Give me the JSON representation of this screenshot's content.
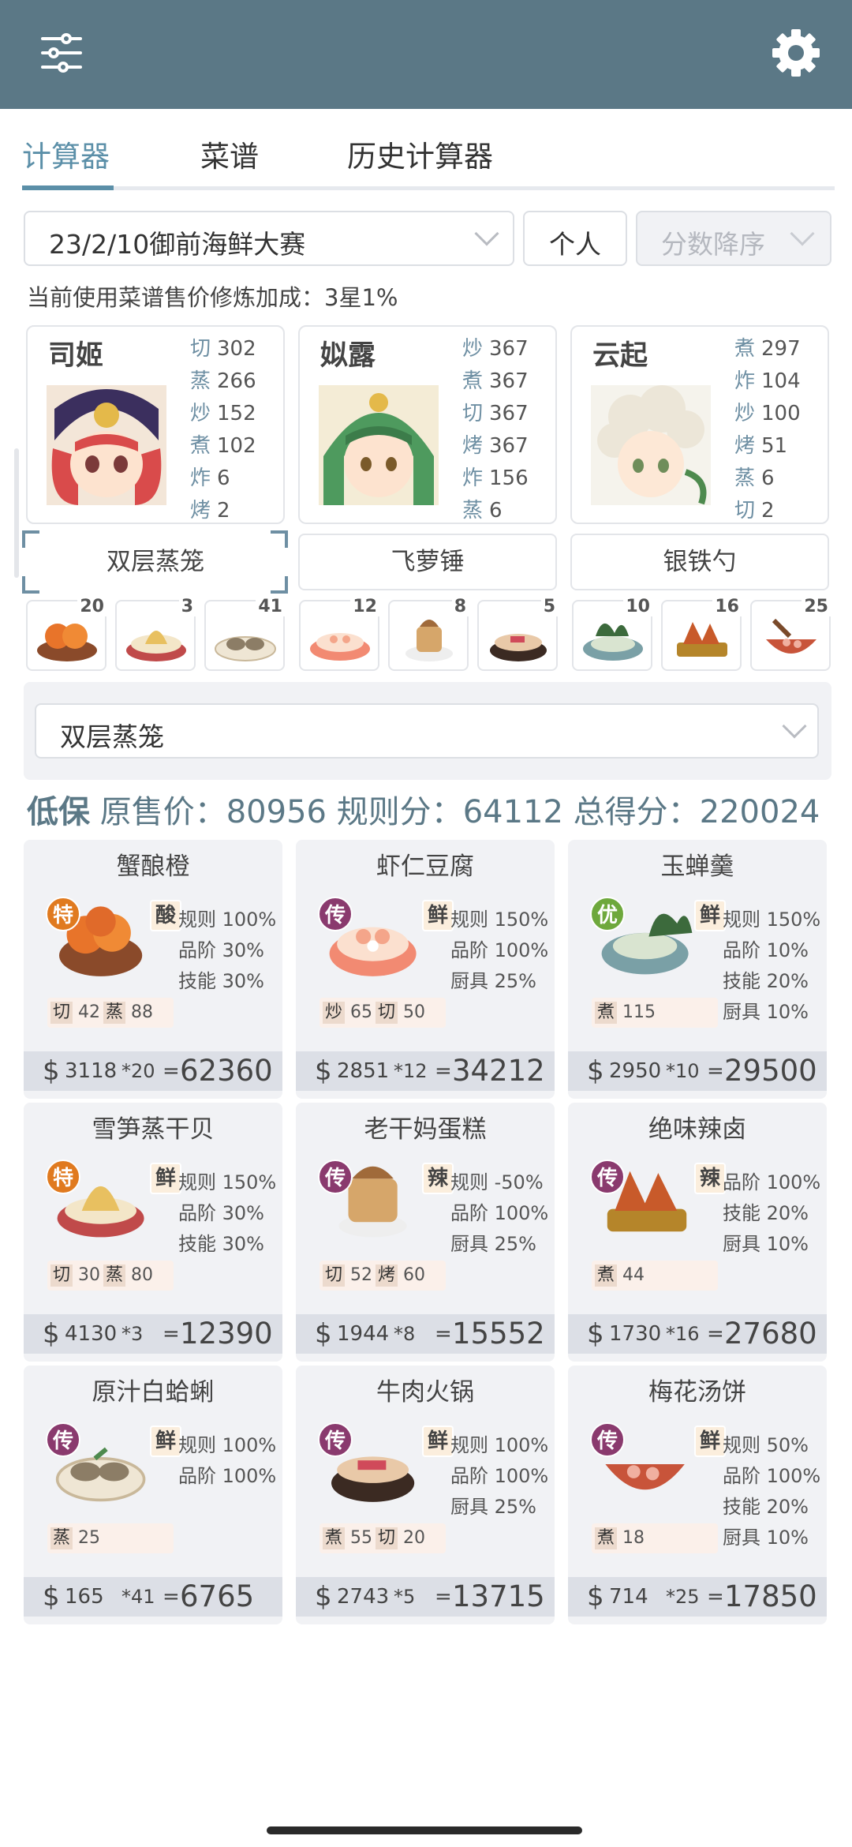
{
  "header": {
    "filter_icon": "sliders-icon",
    "settings_icon": "gear-icon"
  },
  "tabs": [
    {
      "label": "计算器",
      "active": true
    },
    {
      "label": "菜谱"
    },
    {
      "label": "历史计算器"
    }
  ],
  "controls": {
    "contest": "23/2/10御前海鲜大赛",
    "personal": "个人",
    "sort": "分数降序"
  },
  "bonus_note": "当前使用菜谱售价修炼加成：3星1%",
  "chefs": [
    {
      "name": "司姬",
      "skills": [
        {
          "k": "切",
          "v": "302"
        },
        {
          "k": "蒸",
          "v": "266"
        },
        {
          "k": "炒",
          "v": "152"
        },
        {
          "k": "煮",
          "v": "102"
        },
        {
          "k": "炸",
          "v": "6"
        },
        {
          "k": "烤",
          "v": "2"
        }
      ],
      "equip": "双层蒸笼"
    },
    {
      "name": "姒露",
      "skills": [
        {
          "k": "炒",
          "v": "367"
        },
        {
          "k": "煮",
          "v": "367"
        },
        {
          "k": "切",
          "v": "367"
        },
        {
          "k": "烤",
          "v": "367"
        },
        {
          "k": "炸",
          "v": "156"
        },
        {
          "k": "蒸",
          "v": "6"
        }
      ],
      "equip": "飞萝锤"
    },
    {
      "name": "云起",
      "skills": [
        {
          "k": "煮",
          "v": "297"
        },
        {
          "k": "炸",
          "v": "104"
        },
        {
          "k": "炒",
          "v": "100"
        },
        {
          "k": "烤",
          "v": "51"
        },
        {
          "k": "蒸",
          "v": "6"
        },
        {
          "k": "切",
          "v": "2"
        }
      ],
      "equip": "银铁勺"
    }
  ],
  "dish_slots": [
    "20",
    "3",
    "41",
    "12",
    "8",
    "5",
    "10",
    "16",
    "25"
  ],
  "recipe_select": "双层蒸笼",
  "summary": {
    "guarantee": "低保",
    "orig_label": "原售价：",
    "orig": "80956",
    "rule_label": "规则分：",
    "rule": "64112",
    "total_label": "总得分：",
    "total": "220024"
  },
  "recipes": [
    {
      "name": "蟹酿橙",
      "rarity": "特",
      "flavor": "酸",
      "bonuses": [
        "规则 100%",
        "品阶 30%",
        "技能 30%"
      ],
      "reqs": [
        {
          "k": "切",
          "v": "42"
        },
        {
          "k": "蒸",
          "v": "88"
        }
      ],
      "price": "3118",
      "qty": "*20",
      "total": "62360"
    },
    {
      "name": "虾仁豆腐",
      "rarity": "传",
      "flavor": "鲜",
      "bonuses": [
        "规则 150%",
        "品阶 100%",
        "厨具 25%"
      ],
      "reqs": [
        {
          "k": "炒",
          "v": "65"
        },
        {
          "k": "切",
          "v": "50"
        }
      ],
      "price": "2851",
      "qty": "*12",
      "total": "34212"
    },
    {
      "name": "玉蝉羹",
      "rarity": "优",
      "flavor": "鲜",
      "bonuses": [
        "规则 150%",
        "品阶 10%",
        "技能 20%",
        "厨具 10%"
      ],
      "reqs": [
        {
          "k": "煮",
          "v": "115"
        }
      ],
      "price": "2950",
      "qty": "*10",
      "total": "29500"
    },
    {
      "name": "雪笋蒸干贝",
      "rarity": "特",
      "flavor": "鲜",
      "bonuses": [
        "规则 150%",
        "品阶 30%",
        "技能 30%"
      ],
      "reqs": [
        {
          "k": "切",
          "v": "30"
        },
        {
          "k": "蒸",
          "v": "80"
        }
      ],
      "price": "4130",
      "qty": "*3",
      "total": "12390"
    },
    {
      "name": "老干妈蛋糕",
      "rarity": "传",
      "flavor": "辣",
      "bonuses": [
        "规则 -50%",
        "品阶 100%",
        "厨具 25%"
      ],
      "reqs": [
        {
          "k": "切",
          "v": "52"
        },
        {
          "k": "烤",
          "v": "60"
        }
      ],
      "price": "1944",
      "qty": "*8",
      "total": "15552"
    },
    {
      "name": "绝味辣卤",
      "rarity": "传",
      "flavor": "辣",
      "bonuses": [
        "品阶 100%",
        "技能 20%",
        "厨具 10%"
      ],
      "reqs": [
        {
          "k": "煮",
          "v": "44"
        }
      ],
      "price": "1730",
      "qty": "*16",
      "total": "27680"
    },
    {
      "name": "原汁白蛤蜊",
      "rarity": "传",
      "flavor": "鲜",
      "bonuses": [
        "规则 100%",
        "品阶 100%"
      ],
      "reqs": [
        {
          "k": "蒸",
          "v": "25"
        }
      ],
      "price": "165",
      "qty": "*41",
      "total": "6765"
    },
    {
      "name": "牛肉火锅",
      "rarity": "传",
      "flavor": "鲜",
      "bonuses": [
        "规则 100%",
        "品阶 100%",
        "厨具 25%"
      ],
      "reqs": [
        {
          "k": "煮",
          "v": "55"
        },
        {
          "k": "切",
          "v": "20"
        }
      ],
      "price": "2743",
      "qty": "*5",
      "total": "13715"
    },
    {
      "name": "梅花汤饼",
      "rarity": "传",
      "flavor": "鲜",
      "bonuses": [
        "规则 50%",
        "品阶 100%",
        "技能 20%",
        "厨具 10%"
      ],
      "reqs": [
        {
          "k": "煮",
          "v": "18"
        }
      ],
      "price": "714",
      "qty": "*25",
      "total": "17850"
    }
  ],
  "colors": {
    "header": "#5b7886",
    "accent": "#5b8fa8",
    "rarity_te": "#e07a1f",
    "rarity_chuan": "#8a3a6e",
    "rarity_you": "#6ea83c"
  }
}
